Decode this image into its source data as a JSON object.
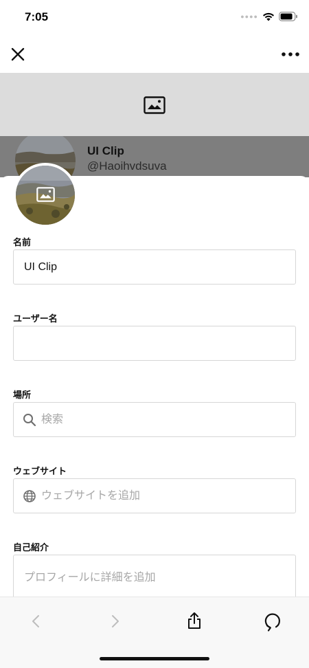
{
  "status_bar": {
    "time": "7:05",
    "signal_icon": "signal-dots-icon",
    "wifi_icon": "wifi-icon",
    "battery_icon": "battery-icon"
  },
  "nav": {
    "close_icon": "close-icon",
    "more_icon": "more-horizontal-icon"
  },
  "banner": {
    "placeholder_icon": "image-icon",
    "background_color": "#dcdcdc"
  },
  "profile": {
    "name": "UI Clip",
    "handle": "@Haoihvdsuva",
    "avatar_icon": "image-icon"
  },
  "form": {
    "name": {
      "label": "名前",
      "value": "UI Clip",
      "placeholder": ""
    },
    "username": {
      "label": "ユーザー名",
      "value": "",
      "placeholder": ""
    },
    "location": {
      "label": "場所",
      "value": "",
      "placeholder": "検索",
      "icon": "search-icon"
    },
    "website": {
      "label": "ウェブサイト",
      "value": "",
      "placeholder": "ウェブサイトを追加",
      "icon": "globe-icon"
    },
    "bio": {
      "label": "自己紹介",
      "value": "",
      "placeholder": "プロフィールに詳細を追加"
    }
  },
  "toolbar": {
    "back_icon": "chevron-left-icon",
    "forward_icon": "chevron-right-icon",
    "share_icon": "share-icon",
    "refresh_icon": "refresh-icon"
  }
}
